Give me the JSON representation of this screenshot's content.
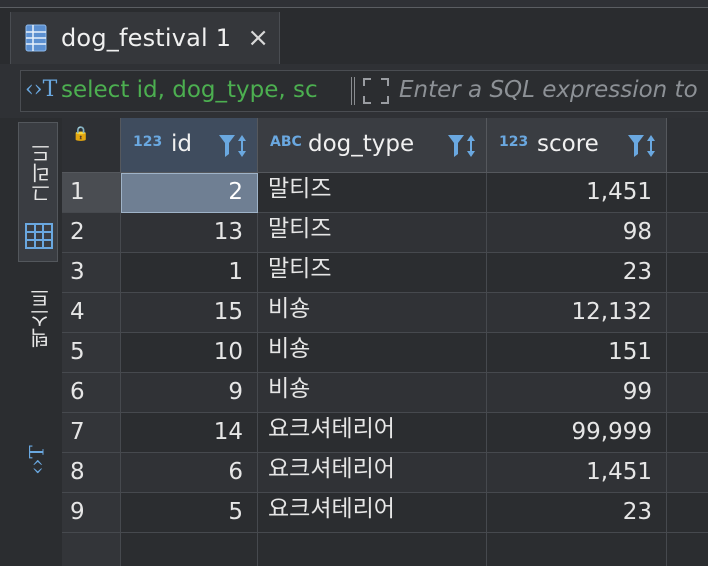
{
  "tab": {
    "title": "dog_festival 1",
    "close": "×"
  },
  "sql": {
    "query": "select id, dog_type, sc",
    "filter_placeholder": "Enter a SQL expression to"
  },
  "side": {
    "grid_label": "그리드",
    "text_label": "텍스트"
  },
  "columns": [
    {
      "type": "123",
      "name": "id"
    },
    {
      "type": "ABC",
      "name": "dog_type"
    },
    {
      "type": "123",
      "name": "score"
    }
  ],
  "rows": [
    {
      "n": "1",
      "id": "2",
      "dog_type": "말티즈",
      "score": "1,451"
    },
    {
      "n": "2",
      "id": "13",
      "dog_type": "말티즈",
      "score": "98"
    },
    {
      "n": "3",
      "id": "1",
      "dog_type": "말티즈",
      "score": "23"
    },
    {
      "n": "4",
      "id": "15",
      "dog_type": "비숑",
      "score": "12,132"
    },
    {
      "n": "5",
      "id": "10",
      "dog_type": "비숑",
      "score": "151"
    },
    {
      "n": "6",
      "id": "9",
      "dog_type": "비숑",
      "score": "99"
    },
    {
      "n": "7",
      "id": "14",
      "dog_type": "요크셔테리어",
      "score": "99,999"
    },
    {
      "n": "8",
      "id": "6",
      "dog_type": "요크셔테리어",
      "score": "1,451"
    },
    {
      "n": "9",
      "id": "5",
      "dog_type": "요크셔테리어",
      "score": "23"
    }
  ],
  "colors": {
    "accent": "#6aa8e0",
    "sql_green": "#4caf50",
    "lock": "#e2b53d"
  }
}
